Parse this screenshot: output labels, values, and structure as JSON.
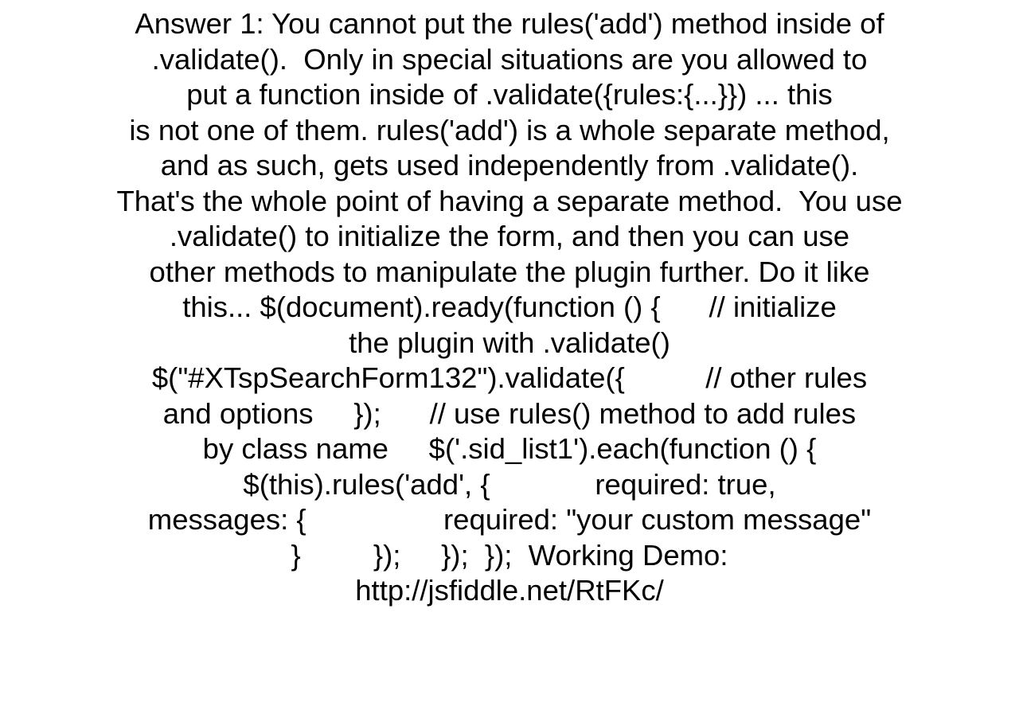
{
  "lines": [
    "Answer 1: You cannot put the rules('add') method inside of",
    ".validate().  Only in special situations are you allowed to",
    "put a function inside of .validate({rules:{...}}) ... this",
    "is not one of them. rules('add') is a whole separate method,",
    "and as such, gets used independently from .validate().",
    "That's the whole point of having a separate method.  You use",
    ".validate() to initialize the form, and then you can use",
    "other methods to manipulate the plugin further. Do it like",
    "this... $(document).ready(function () {      // initialize",
    "the plugin with .validate()",
    "$(\"#XTspSearchForm132\").validate({          // other rules",
    "and options     });      // use rules() method to add rules",
    "by class name     $('.sid_list1').each(function () {",
    "$(this).rules('add', {             required: true,",
    "messages: {                 required: \"your custom message\"",
    "}         });     });  });  Working Demo:",
    "http://jsfiddle.net/RtFKc/"
  ]
}
